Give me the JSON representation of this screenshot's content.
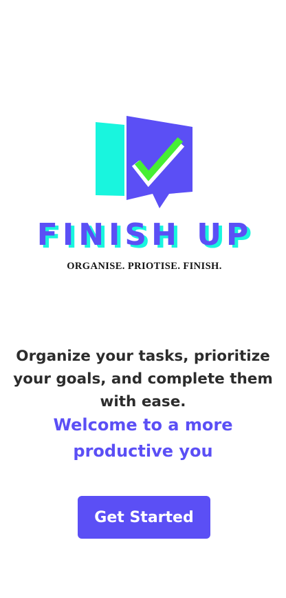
{
  "brand": {
    "name": "FINISH UP",
    "tagline": "ORGANISE. PRIOTISE. FINISH.",
    "icon": "speech-bubble-checkmark-logo",
    "colors": {
      "purple": "#5b4ff5",
      "cyan": "#19f5de",
      "green": "#46ef34"
    }
  },
  "intro": {
    "text": "Organize your tasks, prioritize your goals, and complete them with ease."
  },
  "welcome": {
    "text": "Welcome to a more productive you"
  },
  "cta": {
    "label": "Get Started"
  }
}
